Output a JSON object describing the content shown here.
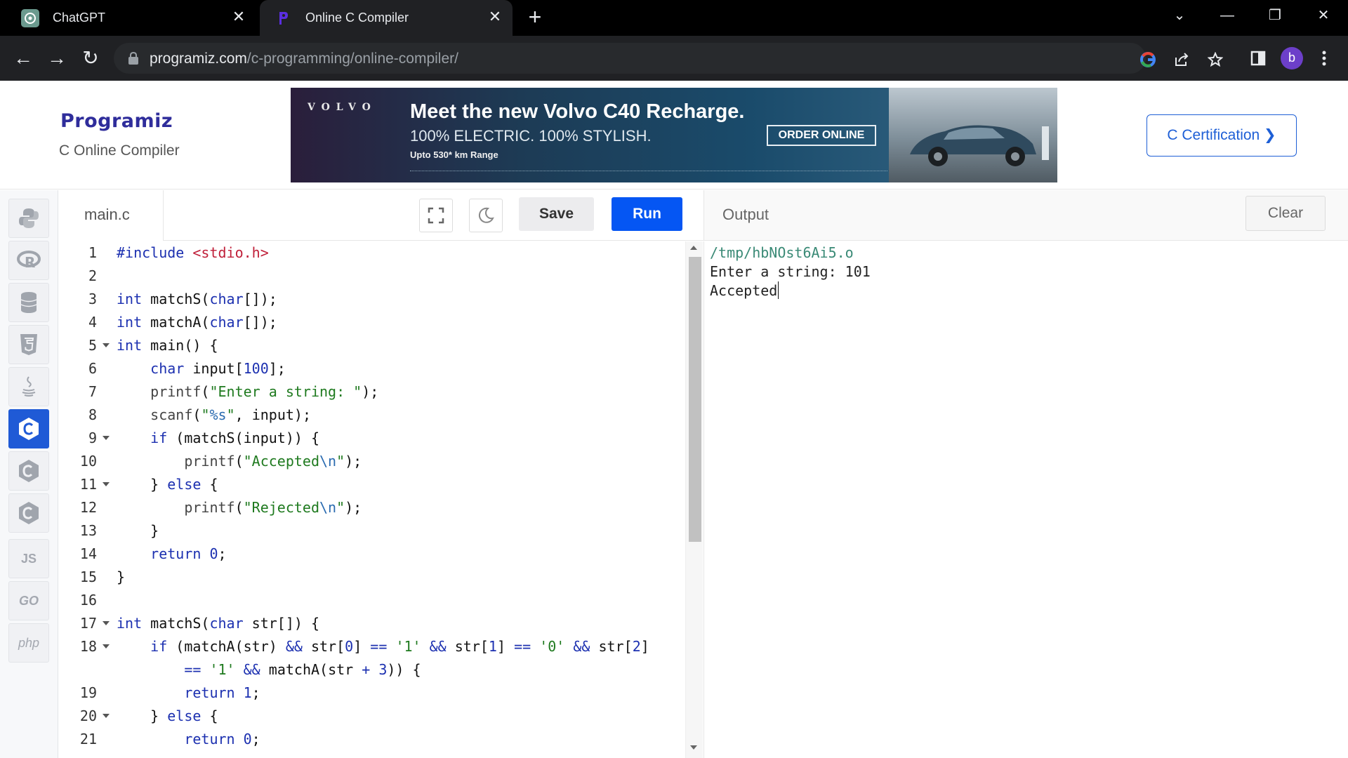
{
  "browser": {
    "tabs": [
      {
        "title": "ChatGPT",
        "active": false
      },
      {
        "title": "Online C Compiler",
        "active": true
      }
    ],
    "url_domain": "programiz.com",
    "url_path": "/c-programming/online-compiler/",
    "profile_initial": "b"
  },
  "header": {
    "logo_text": "Programiz",
    "subtitle": "C Online Compiler",
    "cert_button": "C Certification ❯"
  },
  "ad": {
    "brand": "VOLVO",
    "headline": "Meet the new Volvo C40 Recharge.",
    "subline": "100% ELECTRIC. 100% STYLISH.",
    "range": "Upto 530* km Range",
    "cta": "ORDER ONLINE"
  },
  "languages": [
    {
      "name": "python",
      "label": ""
    },
    {
      "name": "r",
      "label": ""
    },
    {
      "name": "sql",
      "label": ""
    },
    {
      "name": "html",
      "label": ""
    },
    {
      "name": "java",
      "label": ""
    },
    {
      "name": "c",
      "label": "",
      "active": true
    },
    {
      "name": "cpp",
      "label": ""
    },
    {
      "name": "csharp",
      "label": ""
    },
    {
      "name": "js",
      "label": "JS"
    },
    {
      "name": "go",
      "label": "GO"
    },
    {
      "name": "php",
      "label": "php"
    }
  ],
  "editor": {
    "filename": "main.c",
    "save_label": "Save",
    "run_label": "Run",
    "line_numbers": [
      "1",
      "2",
      "3",
      "4",
      "5",
      "6",
      "7",
      "8",
      "9",
      "10",
      "11",
      "12",
      "13",
      "14",
      "15",
      "16",
      "17",
      "18",
      "",
      "19",
      "20",
      "21"
    ],
    "fold_lines": [
      5,
      9,
      11,
      17,
      18,
      20
    ]
  },
  "output": {
    "title": "Output",
    "clear_label": "Clear",
    "lines": [
      "/tmp/hbNOst6Ai5.o",
      "Enter a string: 101",
      "Accepted"
    ]
  },
  "colors": {
    "accent": "#0556f3",
    "keyword": "#1c30b0",
    "string": "#1f7a1f",
    "include": "#c0203a",
    "output_path": "#3a8a76"
  }
}
